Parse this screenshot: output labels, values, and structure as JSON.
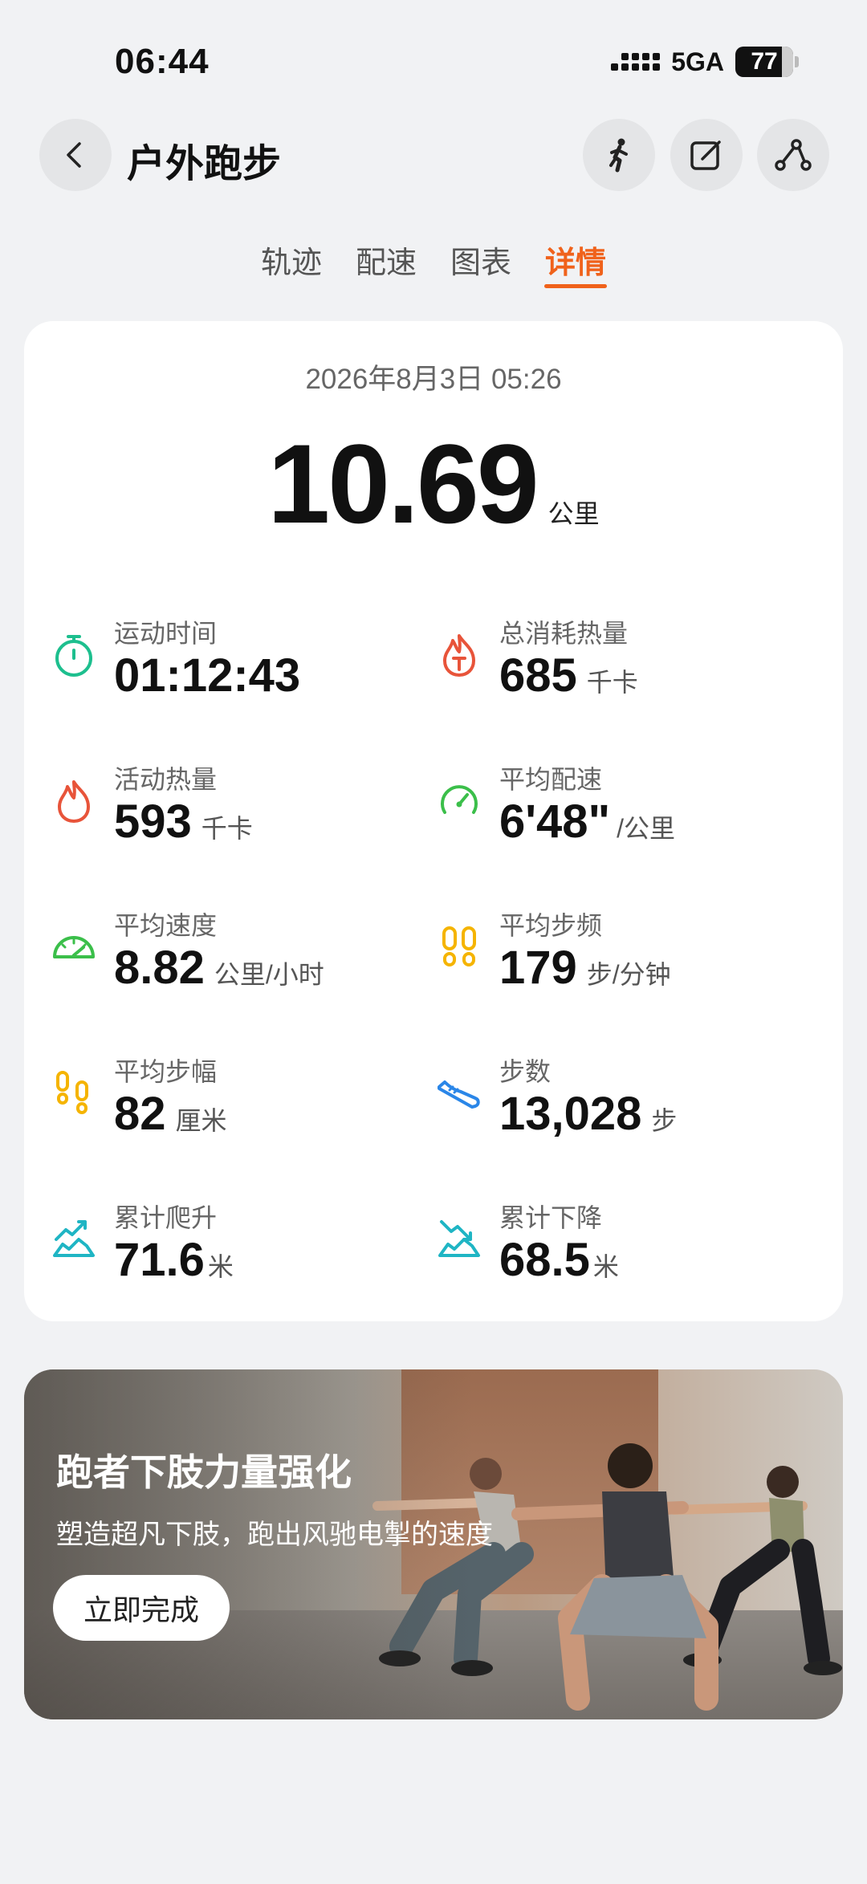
{
  "status": {
    "time": "06:44",
    "network": "5GA",
    "battery": "77"
  },
  "header": {
    "title": "户外跑步"
  },
  "tabs": [
    {
      "label": "轨迹"
    },
    {
      "label": "配速"
    },
    {
      "label": "图表"
    },
    {
      "label": "详情",
      "active": true
    }
  ],
  "summary": {
    "datetime": "2026年8月3日 05:26",
    "distance": "10.69",
    "distance_unit": "公里"
  },
  "metrics": [
    {
      "label": "运动时间",
      "value": "01:12:43",
      "unit": "",
      "icon": "stopwatch-icon",
      "color": "#1dbf8e"
    },
    {
      "label": "总消耗热量",
      "value": "685",
      "unit": "千卡",
      "icon": "flame-total-icon",
      "color": "#e8543a"
    },
    {
      "label": "活动热量",
      "value": "593",
      "unit": "千卡",
      "icon": "flame-icon",
      "color": "#e8543a"
    },
    {
      "label": "平均配速",
      "value": "6'48\"",
      "unit": "/公里",
      "icon": "pace-gauge-icon",
      "color": "#3bbf4a"
    },
    {
      "label": "平均速度",
      "value": "8.82",
      "unit": "公里/小时",
      "icon": "speedometer-icon",
      "color": "#3bbf4a"
    },
    {
      "label": "平均步频",
      "value": "179",
      "unit": "步/分钟",
      "icon": "footprints-icon",
      "color": "#f5b400"
    },
    {
      "label": "平均步幅",
      "value": "82",
      "unit": "厘米",
      "icon": "stride-icon",
      "color": "#f5b400"
    },
    {
      "label": "步数",
      "value": "13,028",
      "unit": "步",
      "icon": "shoe-icon",
      "color": "#2a86e8"
    },
    {
      "label": "累计爬升",
      "value": "71.6",
      "unit": "米",
      "icon": "ascent-icon",
      "color": "#1fb5c4"
    },
    {
      "label": "累计下降",
      "value": "68.5",
      "unit": "米",
      "icon": "descent-icon",
      "color": "#1fb5c4"
    }
  ],
  "banner": {
    "title": "跑者下肢力量强化",
    "subtitle": "塑造超凡下肢，跑出风驰电掣的速度",
    "button": "立即完成"
  },
  "colors": {
    "accent": "#f0621b",
    "background": "#f1f2f4",
    "card": "#ffffff"
  }
}
